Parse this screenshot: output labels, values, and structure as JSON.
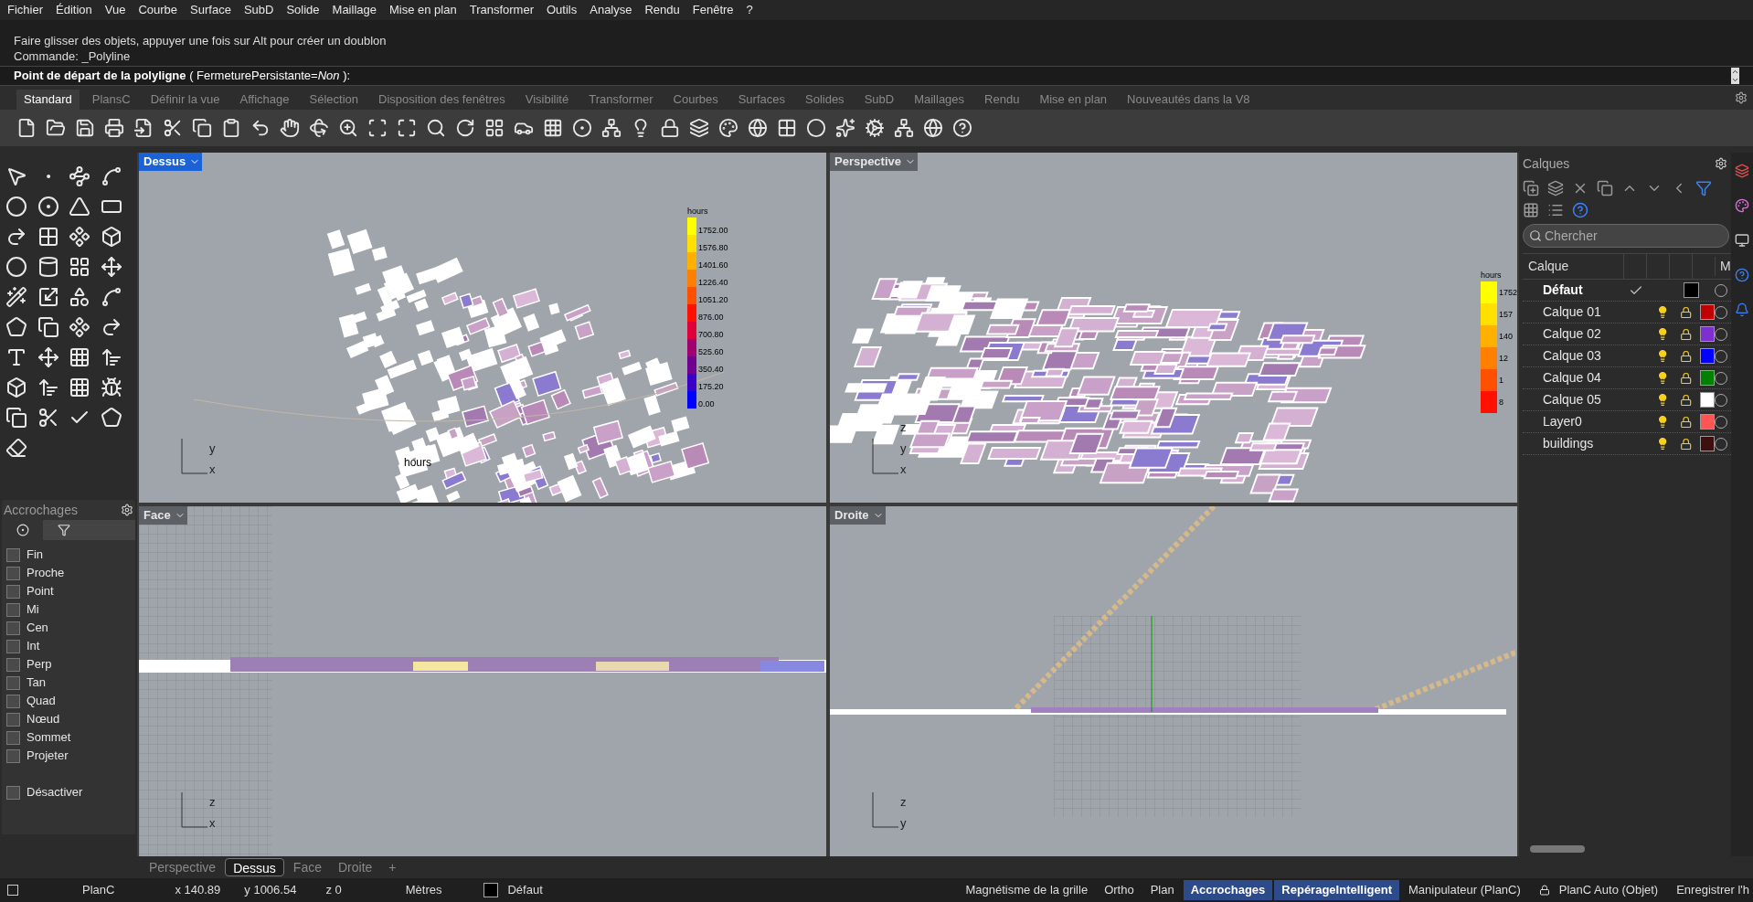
{
  "menu": [
    "Fichier",
    "Édition",
    "Vue",
    "Courbe",
    "Surface",
    "SubD",
    "Solide",
    "Maillage",
    "Mise en plan",
    "Transformer",
    "Outils",
    "Analyse",
    "Rendu",
    "Fenêtre",
    "?"
  ],
  "command": {
    "history": [
      "Faire glisser des objets, appuyer une fois sur Alt pour créer un doublon",
      "Commande: _Polyline"
    ],
    "prompt": "**Point de départ de la polyligne** ( FermeturePersistante=*Non* ):"
  },
  "toolbar_tabs": [
    {
      "label": "Standard",
      "selected": true
    },
    {
      "label": "PlansC",
      "selected": false
    },
    {
      "label": "Définir la vue",
      "selected": false
    },
    {
      "label": "Affichage",
      "selected": false
    },
    {
      "label": "Sélection",
      "selected": false
    },
    {
      "label": "Disposition des fenêtres",
      "selected": false
    },
    {
      "label": "Visibilité",
      "selected": false
    },
    {
      "label": "Transformer",
      "selected": false
    },
    {
      "label": "Courbes",
      "selected": false
    },
    {
      "label": "Surfaces",
      "selected": false
    },
    {
      "label": "Solides",
      "selected": false
    },
    {
      "label": "SubD",
      "selected": false
    },
    {
      "label": "Maillages",
      "selected": false
    },
    {
      "label": "Rendu",
      "selected": false
    },
    {
      "label": "Mise en plan",
      "selected": false
    },
    {
      "label": "Nouveautés dans la V8",
      "selected": false
    }
  ],
  "viewports": [
    {
      "title": "Dessus",
      "selected": true,
      "kind": "top",
      "axes": [
        "y",
        "x"
      ],
      "legend": {
        "title": "hours",
        "labels": [
          "1752.00",
          "1576.80",
          "1401.60",
          "1226.40",
          "1051.20",
          "876.00",
          "700.80",
          "525.60",
          "350.40",
          "175.20",
          "0.00"
        ]
      },
      "caption": "hours"
    },
    {
      "title": "Perspective",
      "selected": false,
      "kind": "perspective",
      "axes": [
        "z",
        "y",
        "x"
      ],
      "legend": {
        "title": "hours",
        "labels": [
          "1752",
          "157",
          "140",
          "12",
          "1",
          "8"
        ]
      }
    },
    {
      "title": "Face",
      "selected": false,
      "kind": "front",
      "axes": [
        "z",
        "x"
      ]
    },
    {
      "title": "Droite",
      "selected": false,
      "kind": "right",
      "axes": [
        "z",
        "y"
      ]
    }
  ],
  "snaps": {
    "title": "Accrochages",
    "items": [
      {
        "label": "Fin",
        "checked": false
      },
      {
        "label": "Proche",
        "checked": false
      },
      {
        "label": "Point",
        "checked": false
      },
      {
        "label": "Mi",
        "checked": false
      },
      {
        "label": "Cen",
        "checked": false
      },
      {
        "label": "Int",
        "checked": false
      },
      {
        "label": "Perp",
        "checked": false
      },
      {
        "label": "Tan",
        "checked": false
      },
      {
        "label": "Quad",
        "checked": false
      },
      {
        "label": "Nœud",
        "checked": false
      },
      {
        "label": "Sommet",
        "checked": false
      },
      {
        "label": "Projeter",
        "checked": false
      }
    ],
    "disable": {
      "label": "Désactiver",
      "checked": false
    }
  },
  "layers": {
    "title": "Calques",
    "search": {
      "placeholder": "Chercher"
    },
    "columns": [
      "Calque",
      "M"
    ],
    "rows": [
      {
        "name": "Défaut",
        "current": true,
        "color": "#000000"
      },
      {
        "name": "Calque 01",
        "current": false,
        "color": "#c00000"
      },
      {
        "name": "Calque 02",
        "current": false,
        "color": "#7f2fd0"
      },
      {
        "name": "Calque 03",
        "current": false,
        "color": "#0000ff"
      },
      {
        "name": "Calque 04",
        "current": false,
        "color": "#008000"
      },
      {
        "name": "Calque 05",
        "current": false,
        "color": "#ffffff"
      },
      {
        "name": "Layer0",
        "current": false,
        "color": "#ff5555"
      },
      {
        "name": "buildings",
        "current": false,
        "color": "#3d1010"
      }
    ]
  },
  "viewport_tabs": [
    {
      "label": "Perspective",
      "selected": false
    },
    {
      "label": "Dessus",
      "selected": true
    },
    {
      "label": "Face",
      "selected": false
    },
    {
      "label": "Droite",
      "selected": false
    },
    {
      "label": "+",
      "selected": false
    }
  ],
  "status_bar": {
    "plane": "PlanC",
    "x": "x 140.89",
    "y": "y 1006.54",
    "z": "z 0",
    "units": "Mètres",
    "layer": {
      "name": "Défaut",
      "color": "#000000"
    },
    "toggles": [
      {
        "label": "Magnétisme de la grille",
        "on": false
      },
      {
        "label": "Ortho",
        "on": false
      },
      {
        "label": "Plan",
        "on": false
      },
      {
        "label": "Accrochages",
        "on": true
      },
      {
        "label": "RepérageIntelligent",
        "on": true
      },
      {
        "label": "Manipulateur (PlanC)",
        "on": false
      }
    ],
    "lock_plane": "PlanC Auto (Objet)",
    "record": "Enregistrer l'h"
  }
}
